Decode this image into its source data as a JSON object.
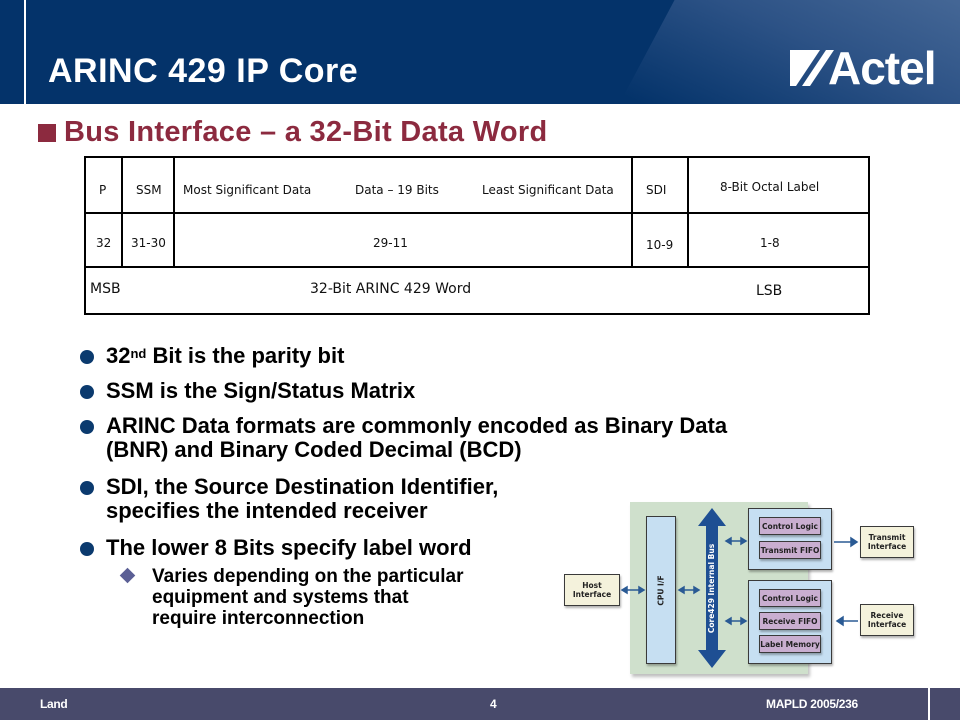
{
  "header": {
    "title": "ARINC 429 IP Core",
    "logo_text": "Actel",
    "logo_icon": "actel-logo-mark-icon"
  },
  "subtitle": {
    "bullet_icon": "square-bullet-icon",
    "text": "Bus Interface – a 32-Bit Data Word"
  },
  "word_table": {
    "header_row": {
      "p": "P",
      "ssm": "SSM",
      "data_msd": "Most Significant Data",
      "data_mid": "Data – 19 Bits",
      "data_lsd": "Least Significant Data",
      "sdi": "SDI",
      "label": "8-Bit Octal Label"
    },
    "bits_row": {
      "p": "32",
      "ssm": "31-30",
      "data": "29-11",
      "sdi": "10-9",
      "label": "1-8"
    },
    "footer_row": {
      "msb": "MSB",
      "word": "32-Bit ARINC 429 Word",
      "lsb": "LSB"
    }
  },
  "bullets": [
    {
      "icon": "circle-bullet-icon",
      "prefix": "32",
      "sup": "nd",
      "text": " Bit is the parity bit"
    },
    {
      "icon": "circle-bullet-icon",
      "text": "SSM is the Sign/Status Matrix"
    },
    {
      "icon": "circle-bullet-icon",
      "lines": [
        "ARINC Data formats are commonly encoded as Binary Data",
        "(BNR) and Binary Coded Decimal (BCD)"
      ]
    },
    {
      "icon": "circle-bullet-icon",
      "lines": [
        "SDI, the Source Destination Identifier,",
        "specifies the intended receiver"
      ]
    },
    {
      "icon": "circle-bullet-icon",
      "text": "The lower 8 Bits specify label word",
      "sub": {
        "icon": "diamond-bullet-icon",
        "lines": [
          "Varies depending on the particular",
          "equipment and systems that",
          "require interconnection"
        ]
      }
    }
  ],
  "diagram": {
    "host_interface": "Host Interface",
    "cpu_if": "CPU I/F",
    "internal_bus": "Core429 Internal Bus",
    "transmit_block": [
      "Control Logic",
      "Transmit FIFO"
    ],
    "receive_block": [
      "Control Logic",
      "Receive FIFO",
      "Label Memory"
    ],
    "transmit_interface": "Transmit Interface",
    "receive_interface": "Receive Interface"
  },
  "footer": {
    "left": "Land",
    "page": "4",
    "right": "MAPLD 2005/236"
  },
  "colors": {
    "header_bg": "#04336a",
    "subtitle": "#8c2a3f",
    "bullet": "#0b3a6e",
    "sub_bullet": "#5b5f95",
    "footer_bg": "#484a6b"
  }
}
